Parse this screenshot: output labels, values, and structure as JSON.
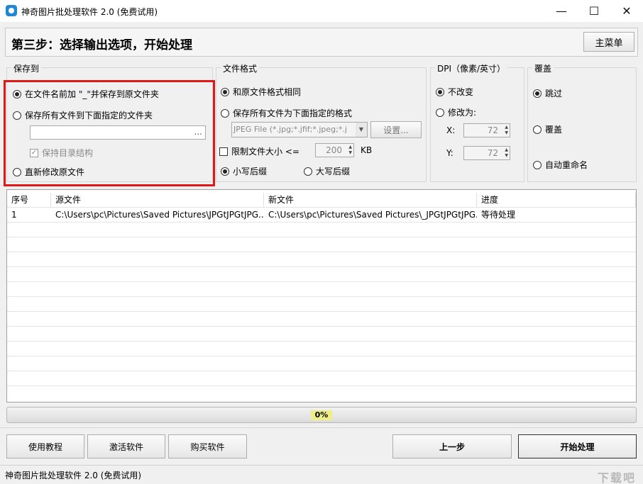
{
  "window": {
    "title": "神奇图片批处理软件 2.0 (免费试用)",
    "minimize": "—",
    "maximize": "☐",
    "close": "✕"
  },
  "header": {
    "step_title": "第三步：选择输出选项，开始处理",
    "main_menu": "主菜单"
  },
  "save_to": {
    "label": "保存到",
    "opt_prefix": "在文件名前加 \"_\"并保存到原文件夹",
    "opt_folder": "保存所有文件到下面指定的文件夹",
    "browse": "...",
    "keep_structure": "保持目录结构",
    "opt_overwrite": "直新修改原文件"
  },
  "file_format": {
    "label": "文件格式",
    "opt_same": "和原文件格式相同",
    "opt_specified": "保存所有文件为下面指定的格式",
    "format_select": "JPEG File (*.jpg;*.jfif;*.jpeg;*.j",
    "settings": "设置...",
    "limit_size": "限制文件大小 <=",
    "limit_value": "200",
    "limit_unit": "KB",
    "lowercase": "小写后缀",
    "uppercase": "大写后缀"
  },
  "dpi": {
    "label": "DPI（像素/英寸）",
    "opt_keep": "不改变",
    "opt_change": "修改为:",
    "x_label": "X:",
    "x_value": "72",
    "y_label": "Y:",
    "y_value": "72"
  },
  "overwrite": {
    "label": "覆盖",
    "opt_skip": "跳过",
    "opt_overwrite": "覆盖",
    "opt_rename": "自动重命名"
  },
  "table": {
    "columns": [
      "序号",
      "源文件",
      "新文件",
      "进度"
    ],
    "rows": [
      [
        "1",
        "C:\\Users\\pc\\Pictures\\Saved Pictures\\JPGtJPGtJPG...",
        "C:\\Users\\pc\\Pictures\\Saved Pictures\\_JPGtJPGtJPG...",
        "等待处理"
      ]
    ]
  },
  "progress": {
    "text": "0%",
    "value": 0
  },
  "buttons": {
    "tutorial": "使用教程",
    "activate": "激活软件",
    "buy": "购买软件",
    "prev": "上一步",
    "start": "开始处理"
  },
  "status_bar": {
    "text": "神奇图片批处理软件 2.0 (免费试用)",
    "watermark": "下载吧"
  },
  "colors": {
    "highlight": "#e01818",
    "accent_icon": "#1e88d6"
  }
}
